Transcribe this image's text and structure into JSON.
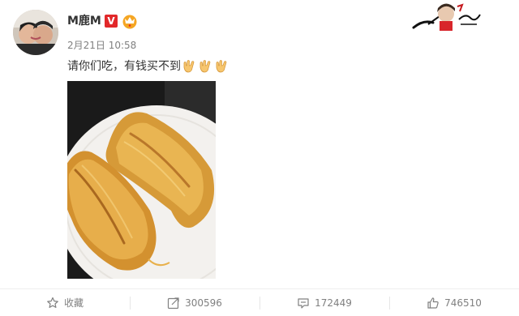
{
  "post": {
    "username": "M鹿M",
    "verified_mark": "V",
    "timestamp": "2月21日 10:58",
    "text": "请你们吃，有钱买不到",
    "emoji_count": 3
  },
  "actions": {
    "favorite_label": "收藏",
    "repost_count": "300596",
    "comment_count": "172449",
    "like_count": "746510"
  },
  "colors": {
    "verified": "#e2282a",
    "vip": "#f5a623",
    "text_gray": "#808080"
  }
}
